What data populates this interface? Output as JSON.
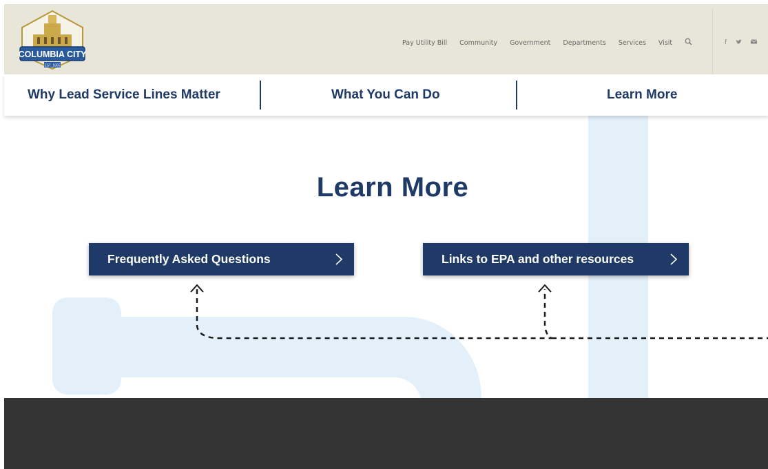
{
  "header": {
    "logo": {
      "text": "COLUMBIA CITY",
      "est": "EST. 1865"
    },
    "nav_items": [
      "Pay Utility Bill",
      "Community",
      "Government",
      "Departments",
      "Services",
      "Visit"
    ],
    "social": [
      "f",
      "twitter",
      "mail"
    ]
  },
  "subnav": {
    "items": [
      "Why Lead Service Lines Matter",
      "What You Can Do",
      "Learn More"
    ]
  },
  "main": {
    "title": "Learn More",
    "buttons": [
      "Frequently Asked Questions",
      "Links to EPA and other resources"
    ]
  },
  "colors": {
    "navy": "#1f3a66",
    "header_bg": "#e8e6d8",
    "pipe": "#e3eff9",
    "footer": "#333333"
  }
}
